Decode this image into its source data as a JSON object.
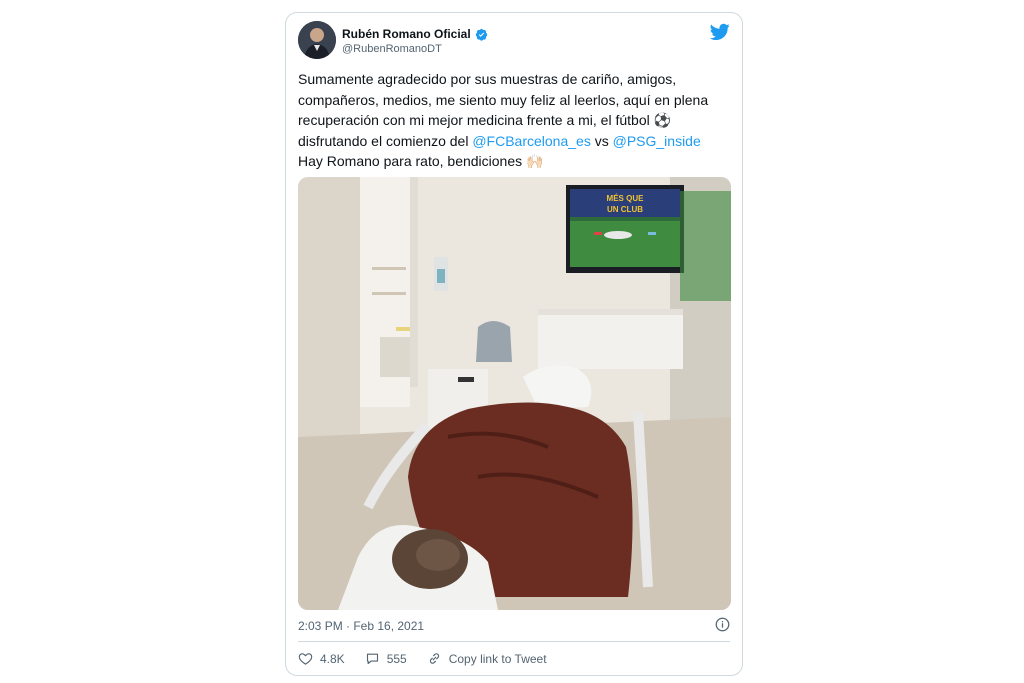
{
  "tweet": {
    "author_name": "Rubén Romano Oficial",
    "author_handle": "@RubenRomanoDT",
    "text_segments": [
      {
        "text": "Sumamente agradecido por sus muestras de cariño, amigos, compañeros, medios, me siento muy feliz al leerlos, aquí en plena recuperación con mi mejor medicina frente a mi, el fútbol ",
        "type": "text"
      },
      {
        "text": "⚽",
        "type": "emoji"
      },
      {
        "text": " disfrutando el comienzo del ",
        "type": "text"
      },
      {
        "text": "@FCBarcelona_es",
        "type": "mention"
      },
      {
        "text": " vs ",
        "type": "text"
      },
      {
        "text": "@PSG_inside",
        "type": "mention"
      },
      {
        "text": " Hay Romano para rato, bendiciones ",
        "type": "text"
      },
      {
        "text": "🙌🏻",
        "type": "emoji"
      }
    ],
    "timestamp": "2:03 PM · Feb 16, 2021",
    "likes": "4.8K",
    "replies": "555",
    "copy_link_label": "Copy link to Tweet",
    "tv_banner_text": "MÉS QUE UN CLUB"
  },
  "colors": {
    "accent": "#1d9bf0",
    "text": "#0f1419",
    "muted": "#536471",
    "border": "#cfd9de"
  },
  "icons": {
    "verified": "verified-badge-icon",
    "brand": "twitter-bird-icon",
    "info": "info-circle-icon",
    "like": "heart-icon",
    "reply": "speech-bubble-icon",
    "link": "link-icon"
  }
}
